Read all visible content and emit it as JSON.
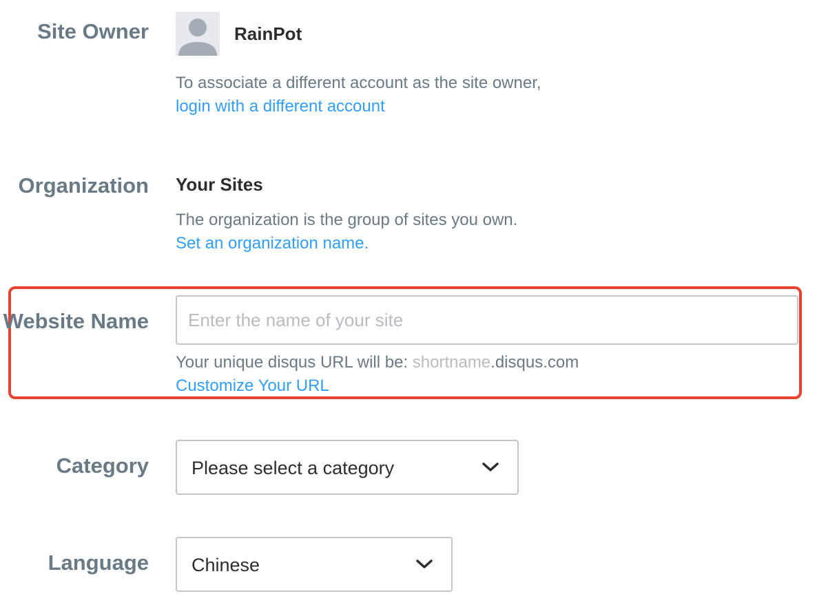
{
  "site_owner": {
    "label": "Site Owner",
    "name": "RainPot",
    "help_text": "To associate a different account as the site owner,",
    "link": "login with a different account"
  },
  "organization": {
    "label": "Organization",
    "name": "Your Sites",
    "help_text": "The organization is the group of sites you own.",
    "link": "Set an organization name."
  },
  "website_name": {
    "label": "Website Name",
    "placeholder": "Enter the name of your site",
    "value": "",
    "url_prefix": "Your unique disqus URL will be: ",
    "url_shortname": "shortname",
    "url_suffix": ".disqus.com",
    "link": "Customize Your URL"
  },
  "category": {
    "label": "Category",
    "selected": "Please select a category"
  },
  "language": {
    "label": "Language",
    "selected": "Chinese"
  },
  "icons": {
    "avatar": "default-avatar-icon",
    "dropdown": "chevron-down-icon"
  },
  "colors": {
    "label": "#687a86",
    "link": "#2e9fff",
    "highlight": "#e8412f",
    "border": "#c2c6cc"
  }
}
